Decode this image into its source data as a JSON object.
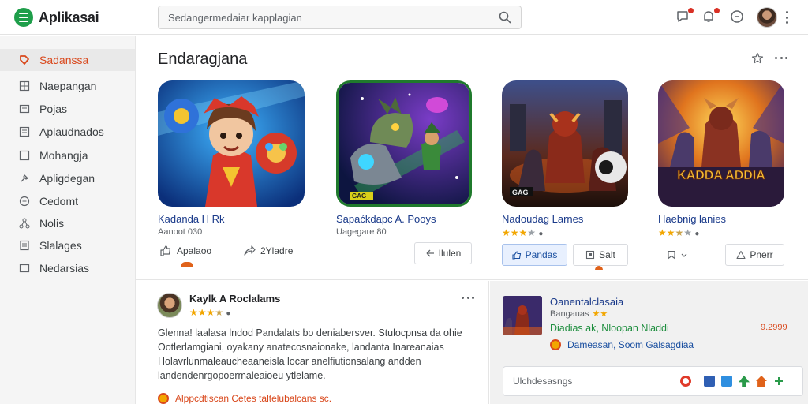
{
  "header": {
    "app_title": "Aplikasai",
    "search_placeholder": "Sedangermedaiar kapplagian",
    "colors": {
      "brand": "#1e9e4a",
      "accent": "#d9481c"
    }
  },
  "sidebar": {
    "items": [
      {
        "label": "Sadanssa",
        "icon": "tag-icon",
        "active": true
      },
      {
        "label": "Naepangan",
        "icon": "grid-icon"
      },
      {
        "label": "Pojas",
        "icon": "box-icon"
      },
      {
        "label": "Aplaudnados",
        "icon": "list-icon"
      },
      {
        "label": "Mohangja",
        "icon": "square-icon"
      },
      {
        "label": "Apligdegan",
        "icon": "pin-icon"
      },
      {
        "label": "Cedomt",
        "icon": "clock-icon"
      },
      {
        "label": "Nolis",
        "icon": "network-icon"
      },
      {
        "label": "Slalages",
        "icon": "doc-icon"
      },
      {
        "label": "Nedarsias",
        "icon": "box-icon"
      }
    ]
  },
  "section": {
    "title": "Endaragjana",
    "apps": [
      {
        "name": "Kadanda H Rk",
        "sub": "Aanoot 030",
        "rating": 0,
        "actions": [
          "Apalaoo",
          "2Yladre",
          "Ilulen"
        ]
      },
      {
        "name": "Sapaćkdapc A. Pooys",
        "sub": "Uagegare 80",
        "rating": 0,
        "actions": []
      },
      {
        "name": "Nadoudag Larnes",
        "sub": "",
        "rating": 3,
        "actions": [
          "Pandas",
          "Salt"
        ]
      },
      {
        "name": "Haebnig lanies",
        "sub": "",
        "rating": 2.5,
        "actions": [
          "Pnerr"
        ]
      }
    ],
    "banner_texts": {
      "app4_banner": "KADDA ADDIA",
      "app2_tag": "GAG",
      "app3_tag": "GAG"
    }
  },
  "review": {
    "author": "Kaylk A Roclalams",
    "rating": 3.5,
    "body": "Glenna! laalasa lndod Pandalats bo deniabersver. Stulocpnsa da ohie Ootlerlamgiani, oyakany anatecosnaionake, landanta Inareanaias Holavrlunmaleaucheaaneisla locar anelfiutionsalang andden landendenrgopoermaleaioeu ytlelame.",
    "body_link": "ytlelame.",
    "footer": "Alppcdtiscan Cetes taltelubalcans sc."
  },
  "promo": {
    "title": "Oanentalclasaia",
    "rating_text": "Bangauas",
    "developer": "Diadias ak, Nloopan Nladdi",
    "price": "9.2999",
    "link_text": "Dameasan, Soom Galsagdiaa",
    "share_label": "Ulchdesasngs",
    "share_icons": [
      "pinterest-icon",
      "facebook-icon",
      "twitter-icon",
      "tree-icon",
      "home-icon",
      "plus-icon"
    ]
  }
}
